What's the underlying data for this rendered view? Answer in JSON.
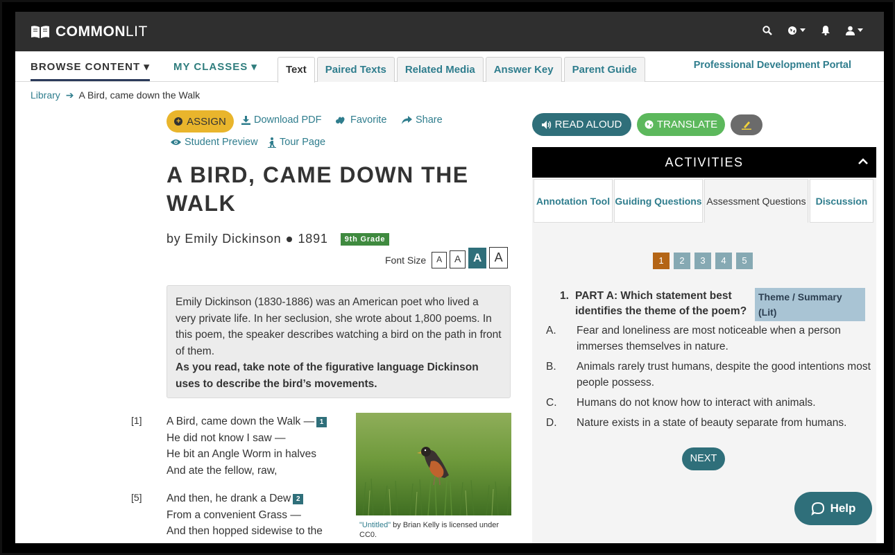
{
  "app": {
    "brand_bold": "COMMON",
    "brand_light": "LIT"
  },
  "nav": {
    "browse": "BROWSE CONTENT ▾",
    "classes": "MY CLASSES ▾",
    "tabs": [
      {
        "label": "Text",
        "active": true
      },
      {
        "label": "Paired Texts"
      },
      {
        "label": "Related Media"
      },
      {
        "label": "Answer Key"
      },
      {
        "label": "Parent Guide"
      }
    ],
    "pd_portal": "Professional Development Portal"
  },
  "breadcrumb": {
    "library": "Library",
    "current": "A Bird, came down the Walk"
  },
  "actions": {
    "assign": "ASSIGN",
    "download": "Download PDF",
    "favorite": "Favorite",
    "share": "Share",
    "preview": "Student Preview",
    "tour": "Tour Page"
  },
  "text": {
    "title": "A BIRD, CAME DOWN THE WALK",
    "byline": "by Emily Dickinson",
    "year": "1891",
    "grade": "9th Grade",
    "font_size_label": "Font Size",
    "intro": "Emily Dickinson (1830-1886) was an American poet who lived a very private life. In her seclusion, she wrote about 1,800 poems. In this poem, the speaker describes watching a bird on the path in front of them.",
    "intro_bold": "As you read, take note of the figurative language Dickinson uses to describe the bird’s movements.",
    "stanza1_num": "[1]",
    "stanza1": [
      "A Bird, came down the Walk —",
      "He did not know I saw —",
      "He bit an Angle Worm in halves",
      "And ate the fellow, raw,"
    ],
    "note1": "1",
    "stanza2_num": "[5]",
    "stanza2": [
      "And then, he drank a Dew",
      "From a convenient Grass —",
      "And then hopped sidewise to the"
    ],
    "note2": "2",
    "caption_link": "\"Untitled\"",
    "caption_rest": " by Brian Kelly is licensed under CC0."
  },
  "tools": {
    "read_aloud": "READ ALOUD",
    "translate": "TRANSLATE"
  },
  "activities": {
    "header": "ACTIVITIES",
    "tabs": [
      "Annotation Tool",
      "Guiding Questions",
      "Assessment Questions",
      "Discussion"
    ],
    "active_tab": "Assessment Questions",
    "pages": [
      "1",
      "2",
      "3",
      "4",
      "5"
    ],
    "current_page": "1",
    "question_num": "1.",
    "question": "PART A: Which statement best identifies the theme of the poem?",
    "tag": "Theme / Summary (Lit)",
    "answers": [
      {
        "letter": "A.",
        "text": "Fear and loneliness are most noticeable when a person immerses themselves in nature."
      },
      {
        "letter": "B.",
        "text": "Animals rarely trust humans, despite the good intentions most people possess."
      },
      {
        "letter": "C.",
        "text": "Humans do not know how to interact with animals."
      },
      {
        "letter": "D.",
        "text": "Nature exists in a state of beauty separate from humans."
      }
    ],
    "next": "NEXT",
    "help": "Help"
  },
  "colors": {
    "teal": "#2f6f7a",
    "link": "#2f7d8d",
    "assign": "#e9b52c",
    "translate": "#5cb85c",
    "active_page": "#b46516"
  }
}
